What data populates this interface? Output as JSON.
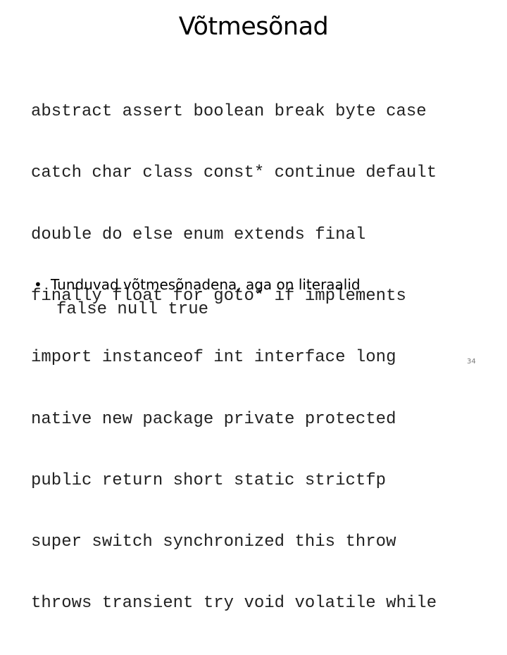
{
  "slide": {
    "title": "Võtmesõnad",
    "keyword_lines": [
      "abstract assert boolean break byte case",
      "catch char class const* continue default",
      "double do else enum extends final",
      "finally float for goto* if implements",
      "import instanceof int interface long",
      "native new package private protected",
      "public return short static strictfp",
      "super switch synchronized this throw",
      "throws transient try void volatile while"
    ],
    "bullet": {
      "marker": "•",
      "text": "Tunduvad võtmesõnadena, aga on literaalid",
      "code": "false null true"
    },
    "page_number": "34"
  }
}
